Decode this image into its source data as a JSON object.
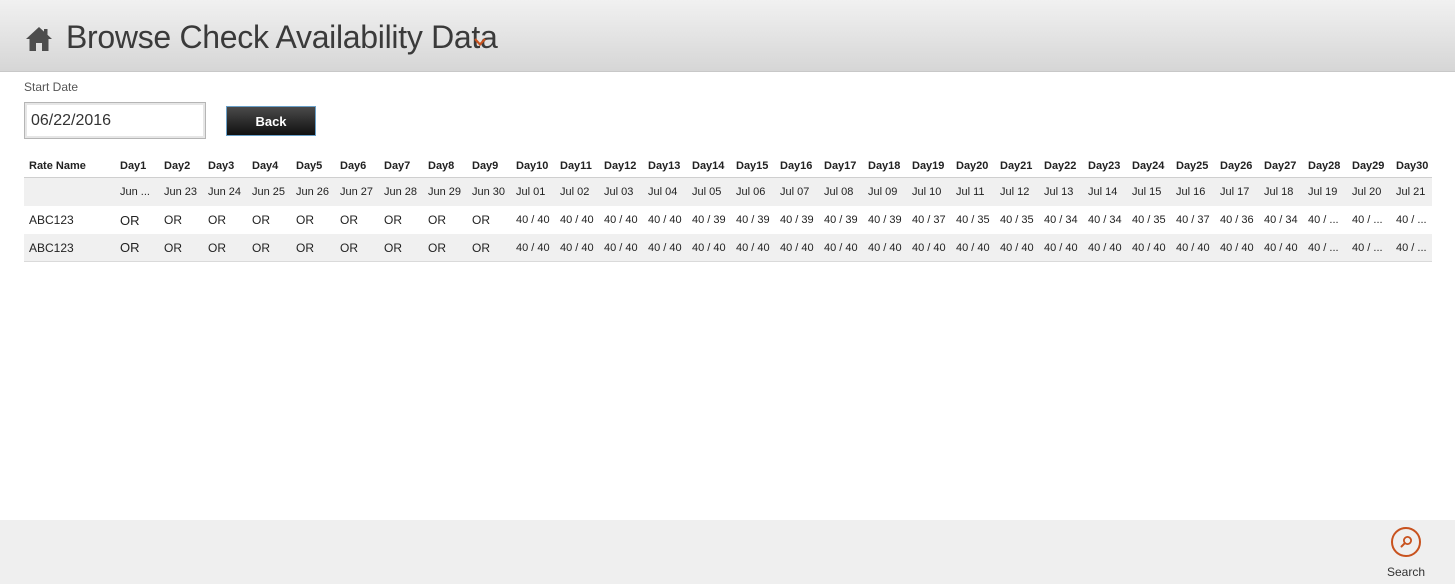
{
  "header": {
    "title": "Browse Check Availability Data",
    "icons": {
      "home": "home-icon",
      "caret": "chevron-down-icon"
    },
    "accent_color": "#c8521e"
  },
  "filter": {
    "start_date_label": "Start Date",
    "start_date_value": "06/22/2016",
    "back_label": "Back"
  },
  "table": {
    "rate_name_header": "Rate Name",
    "days": [
      "Day1",
      "Day2",
      "Day3",
      "Day4",
      "Day5",
      "Day6",
      "Day7",
      "Day8",
      "Day9",
      "Day10",
      "Day11",
      "Day12",
      "Day13",
      "Day14",
      "Day15",
      "Day16",
      "Day17",
      "Day18",
      "Day19",
      "Day20",
      "Day21",
      "Day22",
      "Day23",
      "Day24",
      "Day25",
      "Day26",
      "Day27",
      "Day28",
      "Day29",
      "Day30"
    ],
    "dates": [
      "Jun ...",
      "Jun 23",
      "Jun 24",
      "Jun 25",
      "Jun 26",
      "Jun 27",
      "Jun 28",
      "Jun 29",
      "Jun 30",
      "Jul 01",
      "Jul 02",
      "Jul 03",
      "Jul 04",
      "Jul 05",
      "Jul 06",
      "Jul 07",
      "Jul 08",
      "Jul 09",
      "Jul 10",
      "Jul 11",
      "Jul 12",
      "Jul 13",
      "Jul 14",
      "Jul 15",
      "Jul 16",
      "Jul 17",
      "Jul 18",
      "Jul 19",
      "Jul 20",
      "Jul 21"
    ],
    "rows": [
      {
        "name": "ABC123",
        "values": [
          "OR",
          "OR",
          "OR",
          "OR",
          "OR",
          "OR",
          "OR",
          "OR",
          "OR",
          "40 / 40",
          "40 / 40",
          "40 / 40",
          "40 / 40",
          "40 / 39",
          "40 / 39",
          "40 / 39",
          "40 / 39",
          "40 / 39",
          "40 / 37",
          "40 / 35",
          "40 / 35",
          "40 / 34",
          "40 / 34",
          "40 / 35",
          "40 / 37",
          "40 / 36",
          "40 / 34",
          "40 / ...",
          "40 / ...",
          "40 / ..."
        ]
      },
      {
        "name": "ABC123",
        "values": [
          "OR",
          "OR",
          "OR",
          "OR",
          "OR",
          "OR",
          "OR",
          "OR",
          "OR",
          "40 / 40",
          "40 / 40",
          "40 / 40",
          "40 / 40",
          "40 / 40",
          "40 / 40",
          "40 / 40",
          "40 / 40",
          "40 / 40",
          "40 / 40",
          "40 / 40",
          "40 / 40",
          "40 / 40",
          "40 / 40",
          "40 / 40",
          "40 / 40",
          "40 / 40",
          "40 / 40",
          "40 / ...",
          "40 / ...",
          "40 / ..."
        ]
      }
    ]
  },
  "footer": {
    "search_label": "Search",
    "search_icon": "search-icon"
  }
}
